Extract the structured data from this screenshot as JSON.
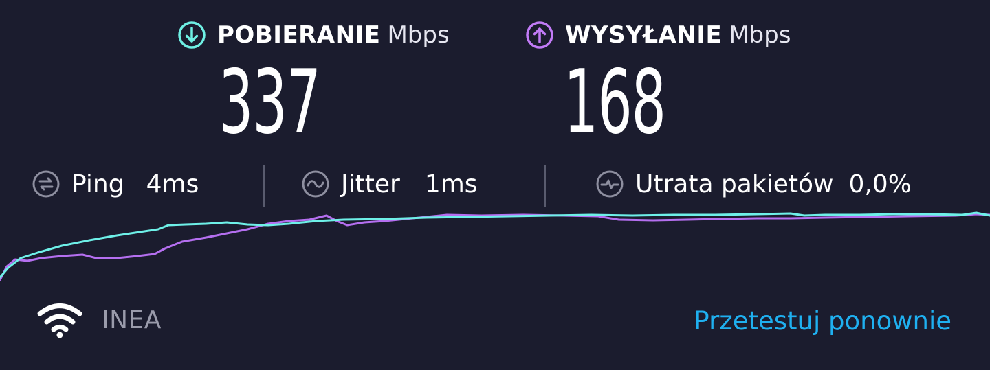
{
  "download": {
    "label": "POBIERANIE",
    "unit": "Mbps",
    "value": "337",
    "icon": "arrow-down-circle-icon",
    "color": "#6ff0e4"
  },
  "upload": {
    "label": "WYSYŁANIE",
    "unit": "Mbps",
    "value": "168",
    "icon": "arrow-up-circle-icon",
    "color": "#c27bf7"
  },
  "stats": {
    "ping": {
      "label": "Ping",
      "value": "4ms",
      "icon": "ping-icon"
    },
    "jitter": {
      "label": "Jitter",
      "value": "1ms",
      "icon": "jitter-icon"
    },
    "packet_loss": {
      "label": "Utrata pakietów",
      "value": "0,0%",
      "icon": "packet-loss-icon"
    }
  },
  "network": {
    "name": "INEA",
    "icon": "wifi-icon"
  },
  "retest_label": "Przetestuj ponownie",
  "colors": {
    "background": "#1b1c2e",
    "accent_link": "#1fb0f0"
  }
}
